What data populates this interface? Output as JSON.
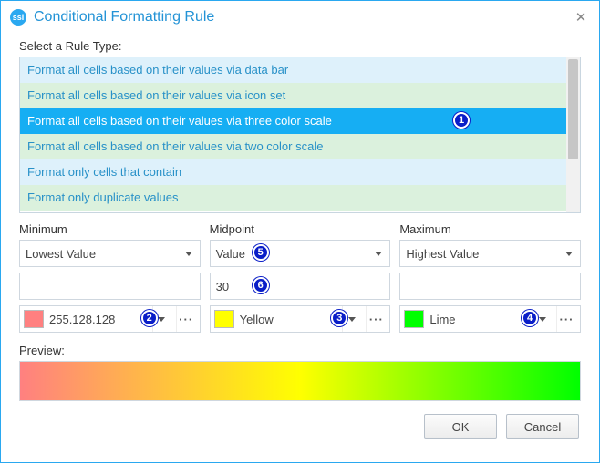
{
  "window": {
    "title": "Conditional Formatting Rule",
    "icon_label": "ssl"
  },
  "section": {
    "select_rule_label": "Select a Rule Type:"
  },
  "rules": [
    {
      "label": "Format all cells based on their values via data bar",
      "tone": "blue",
      "selected": false
    },
    {
      "label": "Format all cells based on their values via icon set",
      "tone": "green",
      "selected": false
    },
    {
      "label": "Format all cells based on their values via three color scale",
      "tone": "blue",
      "selected": true
    },
    {
      "label": "Format all cells based on their values via two color scale",
      "tone": "green",
      "selected": false
    },
    {
      "label": "Format only cells that contain",
      "tone": "blue",
      "selected": false
    },
    {
      "label": "Format only duplicate values",
      "tone": "green",
      "selected": false
    }
  ],
  "columns": {
    "minimum": {
      "label": "Minimum",
      "type": "Lowest Value",
      "value": "",
      "color_label": "255.128.128",
      "color_hex": "#ff8080"
    },
    "midpoint": {
      "label": "Midpoint",
      "type": "Value",
      "value": "30",
      "color_label": "Yellow",
      "color_hex": "#ffff00"
    },
    "maximum": {
      "label": "Maximum",
      "type": "Highest Value",
      "value": "",
      "color_label": "Lime",
      "color_hex": "#00ff00"
    }
  },
  "preview_label": "Preview:",
  "buttons": {
    "ok": "OK",
    "cancel": "Cancel"
  },
  "callouts": [
    "1",
    "2",
    "3",
    "4",
    "5",
    "6"
  ]
}
